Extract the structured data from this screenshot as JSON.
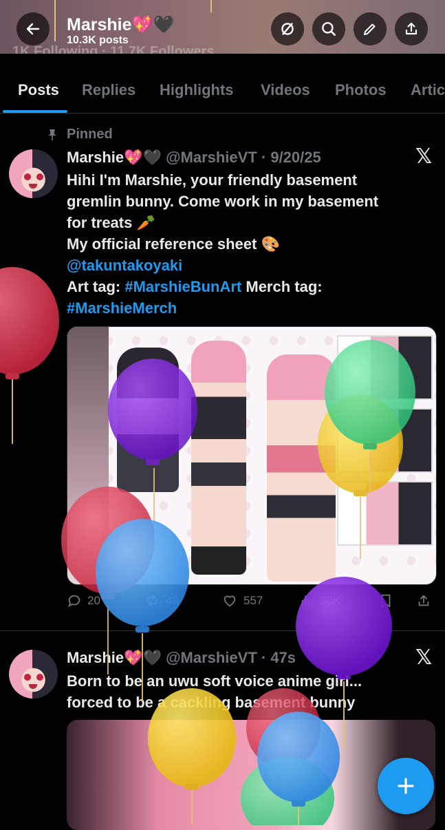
{
  "header": {
    "name": "Marshie💖🖤",
    "posts": "10.3K posts",
    "under_text": "1K Following · 11.7K Followers",
    "icons": [
      "back-arrow-icon",
      "no-eye-icon",
      "search-icon",
      "edit-pen-icon",
      "share-icon"
    ]
  },
  "tabs": [
    {
      "label": "Posts"
    },
    {
      "label": "Replies"
    },
    {
      "label": "Highlights"
    },
    {
      "label": "Videos"
    },
    {
      "label": "Photos"
    },
    {
      "label": "Artic"
    }
  ],
  "post1": {
    "pinned_label": "Pinned",
    "display_name": "Marshie💖🖤",
    "handle_date": "@MarshieVT · 9/20/25",
    "lines": {
      "l1": "Hihi I'm Marshie, your friendly basement",
      "l2": "gremlin bunny. Come work in my basement",
      "l3": "for treats 🥕",
      "l4": "My official reference sheet 🎨",
      "mention": "@takuntakoyaki",
      "art_prefix": "Art tag: ",
      "art_tag": "#MarshieBunArt",
      "merch_prefix": " Merch tag:",
      "merch_tag": "#MarshieMerch"
    },
    "stats": {
      "replies": "20",
      "reposts": "43",
      "likes": "557",
      "views": "30K"
    }
  },
  "post2": {
    "display_name": "Marshie💖🖤",
    "handle_date": "@MarshieVT · 47s",
    "l1": "Born to be an uwu soft voice anime girl...",
    "l2": "forced to be a cackling basement bunny"
  },
  "colors": {
    "accent": "#1d9bf0",
    "background": "#000000",
    "text": "#e7e9ea",
    "muted": "#71767b"
  }
}
